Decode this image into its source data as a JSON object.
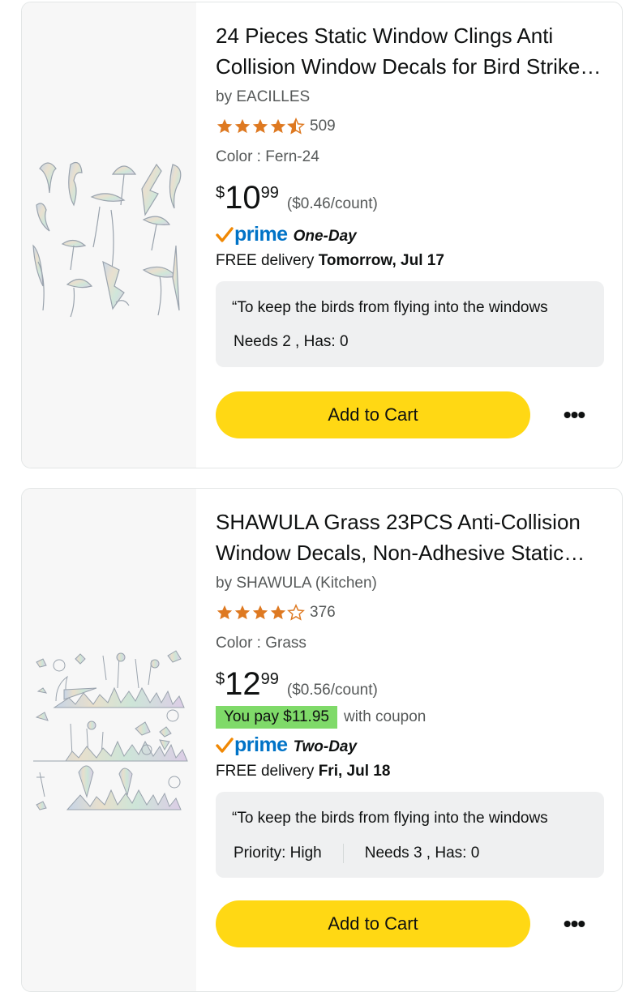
{
  "products": [
    {
      "title": "24 Pieces Static Window Clings Anti Collision Window Decals for Bird Strikes Prevention",
      "brand": "by EACILLES",
      "rating": 4.5,
      "rating_count": "509",
      "color": "Color : Fern-24",
      "price": {
        "symbol": "$",
        "whole": "10",
        "fraction": "99",
        "unit": "($0.46/count)"
      },
      "prime": {
        "word": "prime",
        "speed": "One-Day"
      },
      "delivery": {
        "prefix": "FREE delivery ",
        "date": "Tomorrow, Jul 17"
      },
      "note": {
        "quote": "“To keep the birds from flying into the windows",
        "needs": "Needs 2 , Has: 0"
      },
      "add_to_cart": "Add to Cart",
      "more_icon": "more-dots-icon"
    },
    {
      "title": "SHAWULA Grass 23PCS Anti-Collision Window Decals, Non-Adhesive Static Clings",
      "brand": "by SHAWULA (Kitchen)",
      "rating": 4,
      "rating_count": "376",
      "color": "Color : Grass",
      "price": {
        "symbol": "$",
        "whole": "12",
        "fraction": "99",
        "unit": "($0.56/count)"
      },
      "coupon": {
        "badge": "You pay $11.95",
        "text": "with coupon"
      },
      "prime": {
        "word": "prime",
        "speed": "Two-Day"
      },
      "delivery": {
        "prefix": "FREE delivery ",
        "date": "Fri, Jul 18"
      },
      "note": {
        "quote": "“To keep the birds from flying into the windows",
        "priority": "Priority: High",
        "needs": "Needs 3 , Has: 0"
      },
      "add_to_cart": "Add to Cart",
      "more_icon": "more-dots-icon"
    }
  ],
  "colors": {
    "star": "#de7921",
    "prime_blue": "#0073c7",
    "prime_check": "#f08804",
    "cart_button": "#ffd814",
    "coupon_badge": "#7fda69",
    "note_bg": "#eff0f1"
  }
}
